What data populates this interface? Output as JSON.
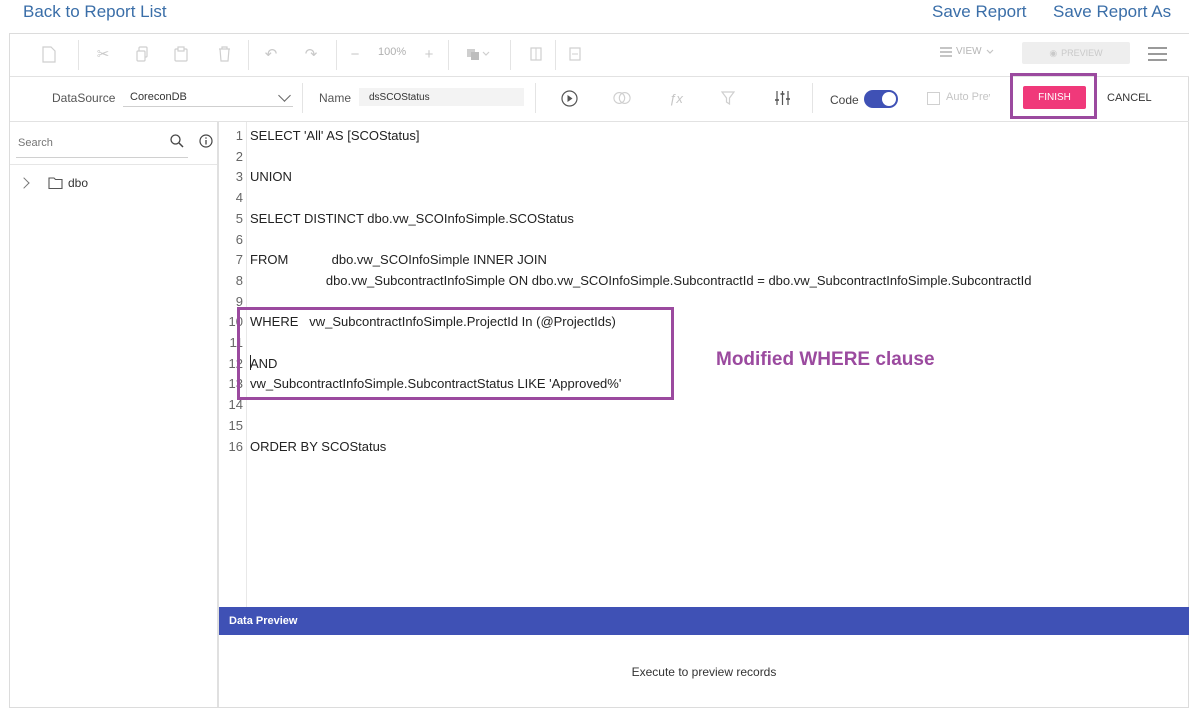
{
  "header": {
    "back_link": "Back to Report List",
    "save_report": "Save Report",
    "save_report_as": "Save Report As"
  },
  "toolbar": {
    "zoom": "100%",
    "view_label": "VIEW",
    "preview_label": "PREVIEW"
  },
  "query_bar": {
    "datasource_label": "DataSource",
    "datasource_value": "CoreconDB",
    "name_label": "Name",
    "name_value": "dsSCOStatus",
    "code_label": "Code",
    "code_toggle_on": true,
    "auto_preview_label": "Auto Preview",
    "finish_label": "FINISH",
    "cancel_label": "CANCEL"
  },
  "sidebar": {
    "search_placeholder": "Search",
    "tree": [
      {
        "label": "dbo"
      }
    ]
  },
  "editor": {
    "lines": [
      {
        "num": "1",
        "text": "SELECT 'All' AS [SCOStatus]"
      },
      {
        "num": "2",
        "text": ""
      },
      {
        "num": "3",
        "text": "UNION"
      },
      {
        "num": "4",
        "text": ""
      },
      {
        "num": "5",
        "text": "SELECT DISTINCT dbo.vw_SCOInfoSimple.SCOStatus"
      },
      {
        "num": "6",
        "text": ""
      },
      {
        "num": "7",
        "text": "FROM            dbo.vw_SCOInfoSimple INNER JOIN"
      },
      {
        "num": "8",
        "text": "                     dbo.vw_SubcontractInfoSimple ON dbo.vw_SCOInfoSimple.SubcontractId = dbo.vw_SubcontractInfoSimple.SubcontractId"
      },
      {
        "num": "9",
        "text": ""
      },
      {
        "num": "10",
        "text": "WHERE   vw_SubcontractInfoSimple.ProjectId In (@ProjectIds)"
      },
      {
        "num": "11",
        "text": ""
      },
      {
        "num": "12",
        "text": "AND"
      },
      {
        "num": "13",
        "text": "vw_SubcontractInfoSimple.SubcontractStatus LIKE 'Approved%'"
      },
      {
        "num": "14",
        "text": ""
      },
      {
        "num": "15",
        "text": ""
      },
      {
        "num": "16",
        "text": "ORDER BY SCOStatus"
      }
    ],
    "annotation": "Modified WHERE clause"
  },
  "data_preview": {
    "title": "Data Preview",
    "message": "Execute to preview records"
  },
  "colors": {
    "accent": "#3f51b5",
    "finish": "#f0397a",
    "highlight": "#9b4a9f",
    "link": "#3a6ea8"
  }
}
